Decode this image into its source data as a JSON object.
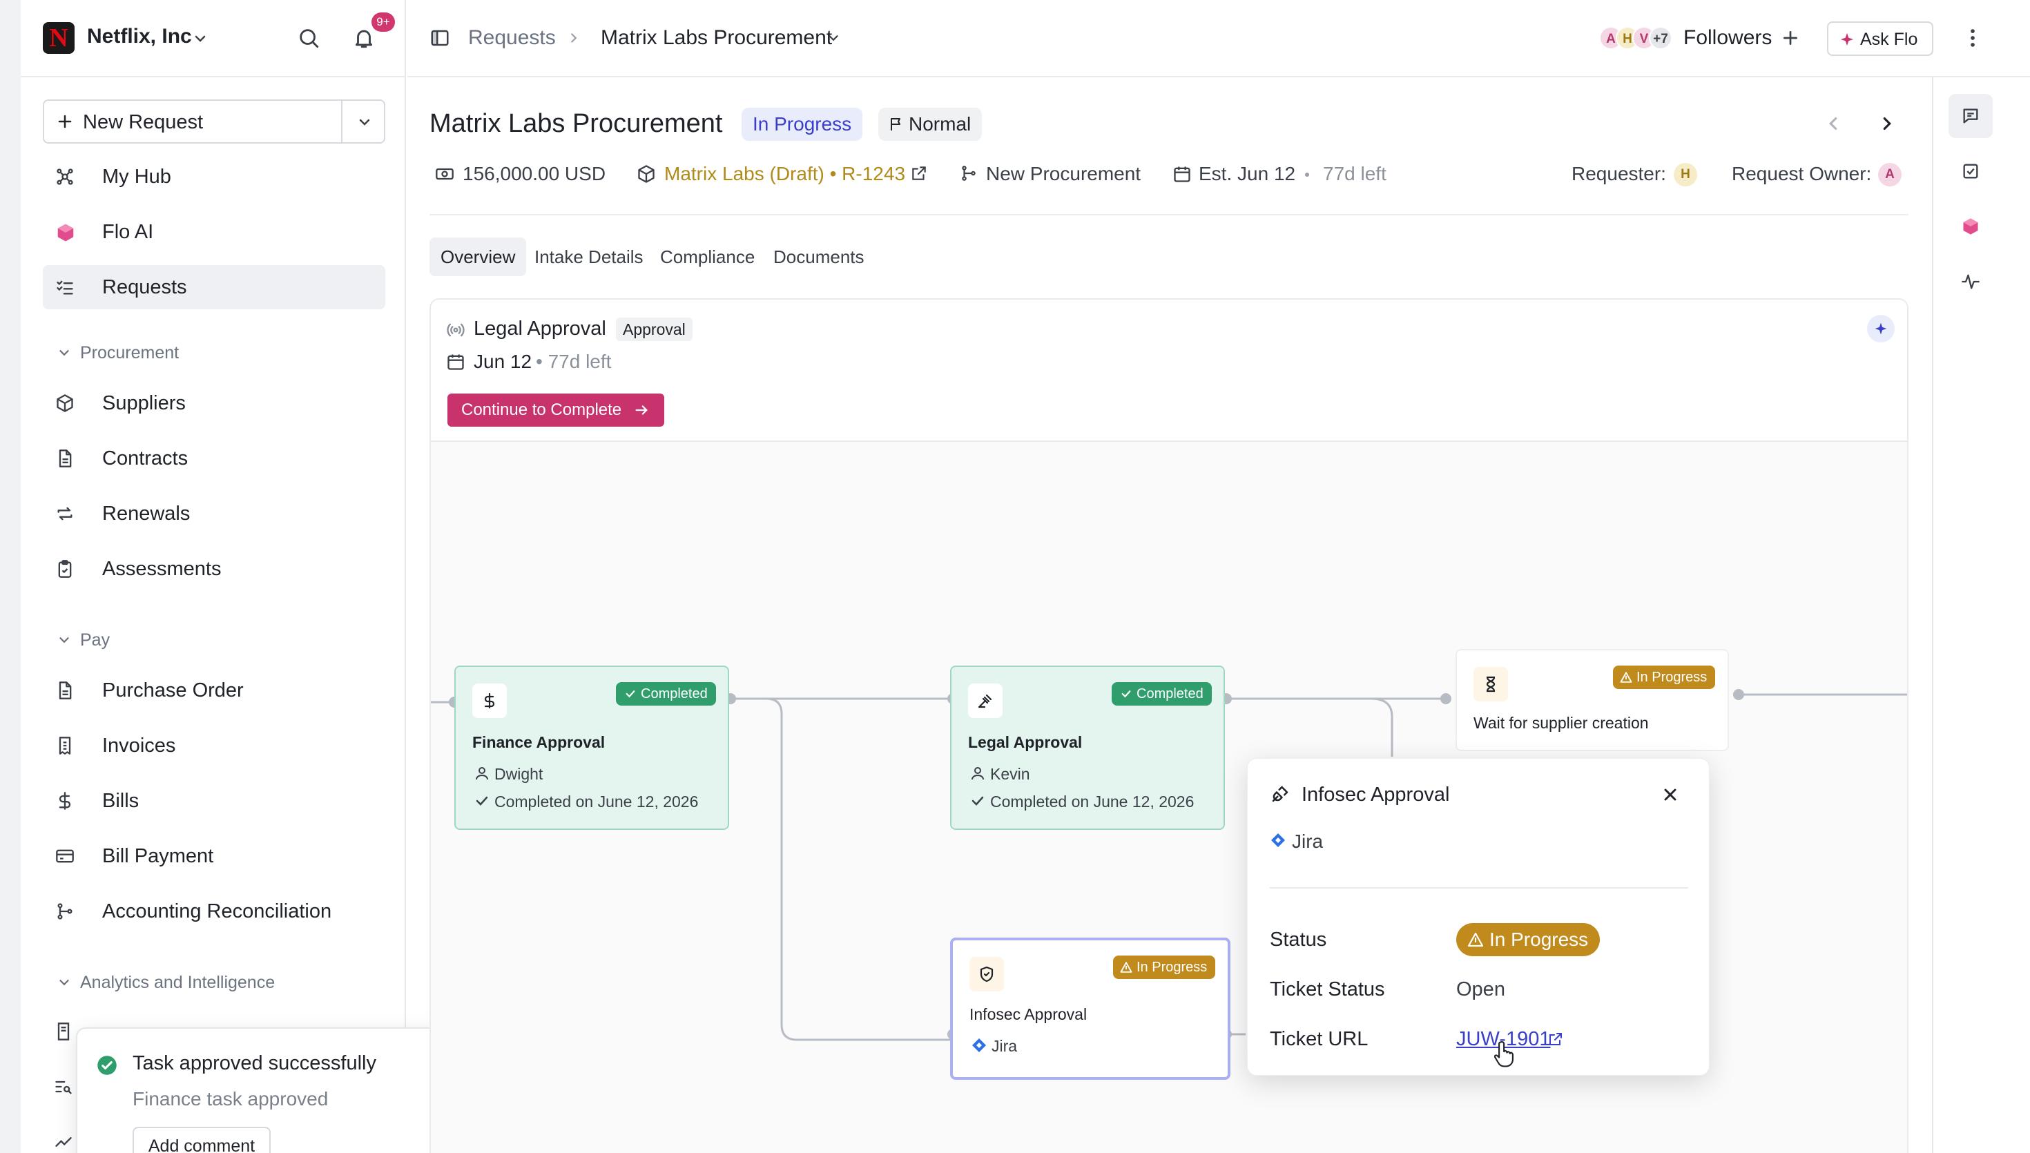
{
  "org": {
    "name": "Netflix, Inc",
    "logo_letter": "N",
    "notif_badge": "9+"
  },
  "sidebar": {
    "new_request_label": "New Request",
    "items_top": [
      {
        "label": "My Hub",
        "icon": "hub-icon"
      },
      {
        "label": "Flo AI",
        "icon": "flo-ai-icon"
      },
      {
        "label": "Requests",
        "icon": "list-checks-icon",
        "active": true
      }
    ],
    "sections": [
      {
        "label": "Procurement",
        "items": [
          "Suppliers",
          "Contracts",
          "Renewals",
          "Assessments"
        ]
      },
      {
        "label": "Pay",
        "items": [
          "Purchase Order",
          "Invoices",
          "Bills",
          "Bill Payment",
          "Accounting Reconciliation"
        ]
      },
      {
        "label": "Analytics and Intelligence",
        "items": []
      }
    ]
  },
  "toast": {
    "title": "Task approved successfully",
    "message": "Finance task approved",
    "button": "Add comment"
  },
  "topbar": {
    "crumb_root": "Requests",
    "crumb_current": "Matrix Labs Procurement",
    "followers_label": "Followers",
    "followers_avatars": [
      "A",
      "H",
      "V",
      "+7"
    ],
    "ask_flo": "Ask Flo"
  },
  "request": {
    "title": "Matrix Labs Procurement",
    "status": "In Progress",
    "priority": "Normal",
    "amount": "156,000.00 USD",
    "supplier": "Matrix Labs (Draft) • R-1243",
    "type": "New Procurement",
    "est_date": "Est. Jun 12",
    "time_left": "77d left",
    "requester_label": "Requester:",
    "requester_avatar": "H",
    "owner_label": "Request Owner:",
    "owner_avatar": "A"
  },
  "tabs": [
    "Overview",
    "Intake Details",
    "Compliance",
    "Documents"
  ],
  "task": {
    "title": "Legal Approval",
    "tag": "Approval",
    "date": "Jun 12",
    "time_left": "• 77d left",
    "cta": "Continue to Complete"
  },
  "flow": {
    "finance": {
      "badge": "Completed",
      "title": "Finance Approval",
      "person": "Dwight",
      "completed": "Completed on June 12, 2026"
    },
    "legal": {
      "badge": "Completed",
      "title": "Legal Approval",
      "person": "Kevin",
      "completed": "Completed on June 12, 2026"
    },
    "wait": {
      "badge": "In Progress",
      "title": "Wait for supplier creation"
    },
    "infosec": {
      "badge": "In Progress",
      "title": "Infosec Approval",
      "source": "Jira"
    }
  },
  "popover": {
    "title": "Infosec Approval",
    "source": "Jira",
    "status_label": "Status",
    "status_value": "In Progress",
    "ticket_status_label": "Ticket Status",
    "ticket_status_value": "Open",
    "ticket_url_label": "Ticket URL",
    "ticket_url_value": "JUW-1901"
  },
  "colors": {
    "accent_pink": "#c8336e",
    "completed_green": "#2f9e6c",
    "in_progress_amber": "#c08a1c",
    "status_blue_bg": "#e9ecfb",
    "link_blue": "#3a3fc9"
  }
}
